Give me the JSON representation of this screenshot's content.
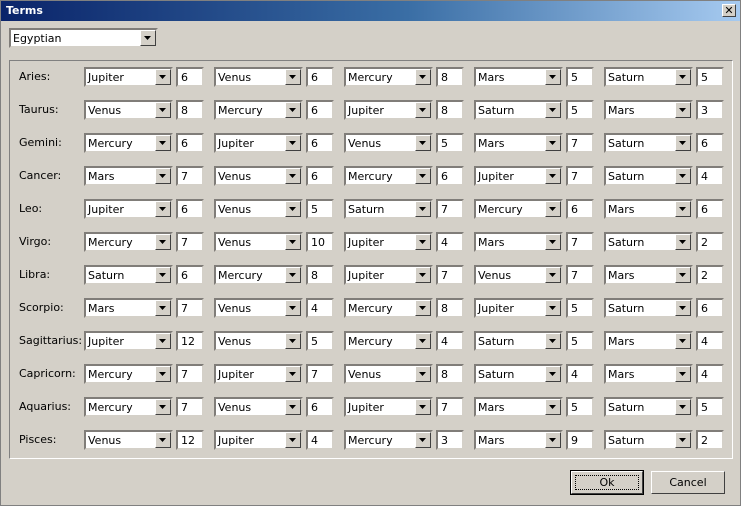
{
  "window": {
    "title": "Terms",
    "close_label": "✕"
  },
  "system": {
    "selected": "Egyptian"
  },
  "rows": [
    {
      "sign": "Aries:",
      "terms": [
        {
          "planet": "Jupiter",
          "degrees": "6"
        },
        {
          "planet": "Venus",
          "degrees": "6"
        },
        {
          "planet": "Mercury",
          "degrees": "8"
        },
        {
          "planet": "Mars",
          "degrees": "5"
        },
        {
          "planet": "Saturn",
          "degrees": "5"
        }
      ]
    },
    {
      "sign": "Taurus:",
      "terms": [
        {
          "planet": "Venus",
          "degrees": "8"
        },
        {
          "planet": "Mercury",
          "degrees": "6"
        },
        {
          "planet": "Jupiter",
          "degrees": "8"
        },
        {
          "planet": "Saturn",
          "degrees": "5"
        },
        {
          "planet": "Mars",
          "degrees": "3"
        }
      ]
    },
    {
      "sign": "Gemini:",
      "terms": [
        {
          "planet": "Mercury",
          "degrees": "6"
        },
        {
          "planet": "Jupiter",
          "degrees": "6"
        },
        {
          "planet": "Venus",
          "degrees": "5"
        },
        {
          "planet": "Mars",
          "degrees": "7"
        },
        {
          "planet": "Saturn",
          "degrees": "6"
        }
      ]
    },
    {
      "sign": "Cancer:",
      "terms": [
        {
          "planet": "Mars",
          "degrees": "7"
        },
        {
          "planet": "Venus",
          "degrees": "6"
        },
        {
          "planet": "Mercury",
          "degrees": "6"
        },
        {
          "planet": "Jupiter",
          "degrees": "7"
        },
        {
          "planet": "Saturn",
          "degrees": "4"
        }
      ]
    },
    {
      "sign": "Leo:",
      "terms": [
        {
          "planet": "Jupiter",
          "degrees": "6"
        },
        {
          "planet": "Venus",
          "degrees": "5"
        },
        {
          "planet": "Saturn",
          "degrees": "7"
        },
        {
          "planet": "Mercury",
          "degrees": "6"
        },
        {
          "planet": "Mars",
          "degrees": "6"
        }
      ]
    },
    {
      "sign": "Virgo:",
      "terms": [
        {
          "planet": "Mercury",
          "degrees": "7"
        },
        {
          "planet": "Venus",
          "degrees": "10"
        },
        {
          "planet": "Jupiter",
          "degrees": "4"
        },
        {
          "planet": "Mars",
          "degrees": "7"
        },
        {
          "planet": "Saturn",
          "degrees": "2"
        }
      ]
    },
    {
      "sign": "Libra:",
      "terms": [
        {
          "planet": "Saturn",
          "degrees": "6"
        },
        {
          "planet": "Mercury",
          "degrees": "8"
        },
        {
          "planet": "Jupiter",
          "degrees": "7"
        },
        {
          "planet": "Venus",
          "degrees": "7"
        },
        {
          "planet": "Mars",
          "degrees": "2"
        }
      ]
    },
    {
      "sign": "Scorpio:",
      "terms": [
        {
          "planet": "Mars",
          "degrees": "7"
        },
        {
          "planet": "Venus",
          "degrees": "4"
        },
        {
          "planet": "Mercury",
          "degrees": "8"
        },
        {
          "planet": "Jupiter",
          "degrees": "5"
        },
        {
          "planet": "Saturn",
          "degrees": "6"
        }
      ]
    },
    {
      "sign": "Sagittarius:",
      "terms": [
        {
          "planet": "Jupiter",
          "degrees": "12"
        },
        {
          "planet": "Venus",
          "degrees": "5"
        },
        {
          "planet": "Mercury",
          "degrees": "4"
        },
        {
          "planet": "Saturn",
          "degrees": "5"
        },
        {
          "planet": "Mars",
          "degrees": "4"
        }
      ]
    },
    {
      "sign": "Capricorn:",
      "terms": [
        {
          "planet": "Mercury",
          "degrees": "7"
        },
        {
          "planet": "Jupiter",
          "degrees": "7"
        },
        {
          "planet": "Venus",
          "degrees": "8"
        },
        {
          "planet": "Saturn",
          "degrees": "4"
        },
        {
          "planet": "Mars",
          "degrees": "4"
        }
      ]
    },
    {
      "sign": "Aquarius:",
      "terms": [
        {
          "planet": "Mercury",
          "degrees": "7"
        },
        {
          "planet": "Venus",
          "degrees": "6"
        },
        {
          "planet": "Jupiter",
          "degrees": "7"
        },
        {
          "planet": "Mars",
          "degrees": "5"
        },
        {
          "planet": "Saturn",
          "degrees": "5"
        }
      ]
    },
    {
      "sign": "Pisces:",
      "terms": [
        {
          "planet": "Venus",
          "degrees": "12"
        },
        {
          "planet": "Jupiter",
          "degrees": "4"
        },
        {
          "planet": "Mercury",
          "degrees": "3"
        },
        {
          "planet": "Mars",
          "degrees": "9"
        },
        {
          "planet": "Saturn",
          "degrees": "2"
        }
      ]
    }
  ],
  "buttons": {
    "ok_label": "Ok",
    "cancel_label": "Cancel"
  }
}
